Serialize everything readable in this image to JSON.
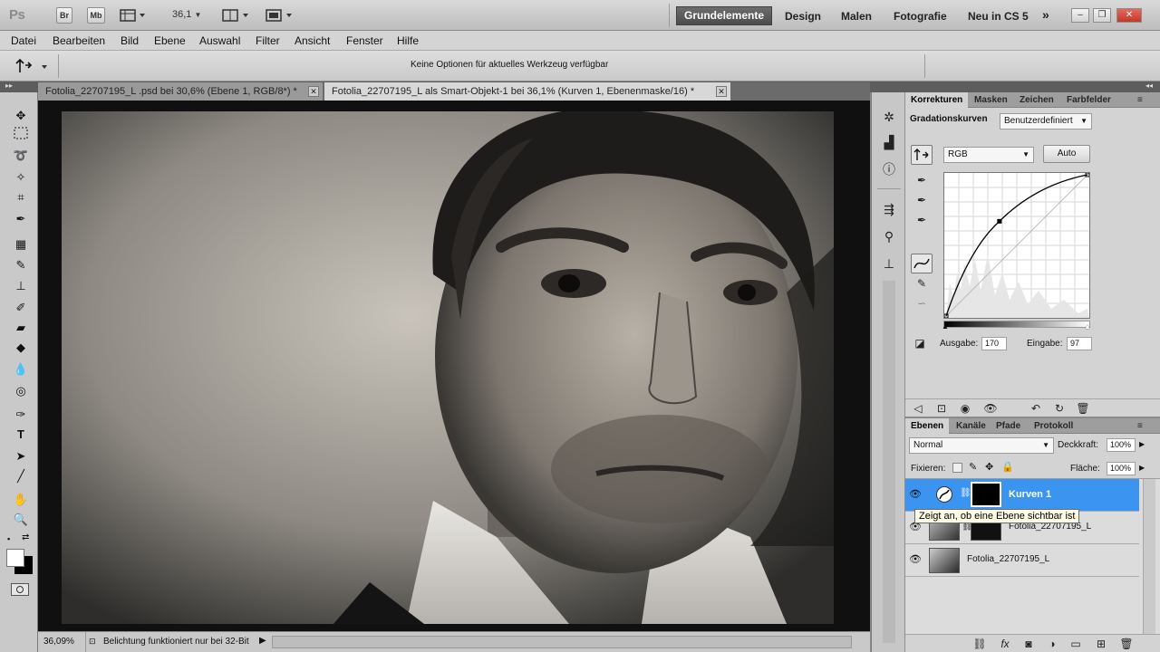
{
  "app": {
    "logo": "Ps",
    "bridge_label": "Br",
    "minibridge_label": "Mb",
    "zoom": "36,1",
    "workspaces": [
      "Grundelemente",
      "Design",
      "Malen",
      "Fotografie",
      "Neu in CS 5"
    ],
    "more": "»",
    "window_buttons": {
      "minimize": "‒",
      "restore": "❐",
      "close": "✕"
    }
  },
  "menu": [
    "Datei",
    "Bearbeiten",
    "Bild",
    "Ebene",
    "Auswahl",
    "Filter",
    "Ansicht",
    "Fenster",
    "Hilfe"
  ],
  "options_bar": {
    "message": "Keine Optionen für aktuelles Werkzeug verfügbar"
  },
  "doc_tabs": [
    {
      "title": "Fotolia_22707195_L .psd bei 30,6% (Ebene 1, RGB/8*) *",
      "active": false
    },
    {
      "title": "Fotolia_22707195_L  als Smart-Objekt-1 bei 36,1% (Kurven 1, Ebenenmaske/16) *",
      "active": true
    }
  ],
  "status": {
    "zoom": "36,09%",
    "message": "Belichtung funktioniert nur bei 32-Bit"
  },
  "adjust_panel": {
    "tabs": [
      "Korrekturen",
      "Masken",
      "Zeichen",
      "Farbfelder"
    ],
    "title": "Gradationskurven",
    "preset": "Benutzerdefiniert",
    "channel": "RGB",
    "auto_label": "Auto",
    "output_label": "Ausgabe:",
    "output_value": "170",
    "input_label": "Eingabe:",
    "input_value": "97",
    "curve_point": {
      "input": 97,
      "output": 170
    },
    "curve_range": [
      0,
      255
    ]
  },
  "layers_panel": {
    "tabs": [
      "Ebenen",
      "Kanäle",
      "Pfade",
      "Protokoll"
    ],
    "blend_mode": "Normal",
    "opacity_label": "Deckkraft:",
    "opacity_value": "100%",
    "lock_label": "Fixieren:",
    "fill_label": "Fläche:",
    "fill_value": "100%",
    "layers": [
      {
        "name": "Kurven 1",
        "selected": true
      },
      {
        "name": "Fotolia_22707195_L",
        "selected": false
      },
      {
        "name": "Fotolia_22707195_L",
        "selected": false
      }
    ],
    "tooltip": "Zeigt an, ob eine Ebene sichtbar ist"
  },
  "colors": {
    "selection_blue": "#3a94f0",
    "active_workspace": "#555555"
  }
}
